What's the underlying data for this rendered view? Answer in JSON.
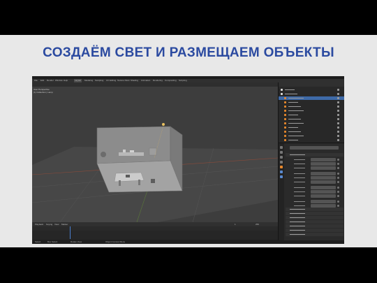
{
  "slide": {
    "title": "СОЗДАЁМ СВЕТ И РАЗМЕЩАЕМ ОБЪЕКТЫ",
    "title_color": "#2b4aa0",
    "background": "#e8e8e8"
  },
  "blender": {
    "window_title": "Blender",
    "menu": [
      "File",
      "Edit",
      "Render",
      "Window",
      "Help",
      "Layout",
      "Modeling",
      "Sculpting",
      "UV Editing",
      "Texture Paint",
      "Shading",
      "Animation",
      "Rendering",
      "Compositing",
      "Scripting"
    ],
    "viewport": {
      "info_lines": [
        "User Perspective",
        "(1) Collection | Lamp"
      ]
    },
    "timeline": {
      "menu": [
        "Playback",
        "Keying",
        "View",
        "Marker"
      ],
      "start_frame": "1",
      "end_frame": "250"
    },
    "status": [
      "Select",
      "Box Select",
      "Rotate View",
      "Object Context Menu"
    ],
    "outliner": {
      "rows": 13
    },
    "properties": {
      "sections": [
        "Transform",
        "Delta Transform",
        "Relations",
        "Collections",
        "Instancing",
        "Motion Paths",
        "Visibility",
        "Viewport Display"
      ],
      "accent": "#e7882c",
      "selection": "#3e6aa8"
    }
  }
}
